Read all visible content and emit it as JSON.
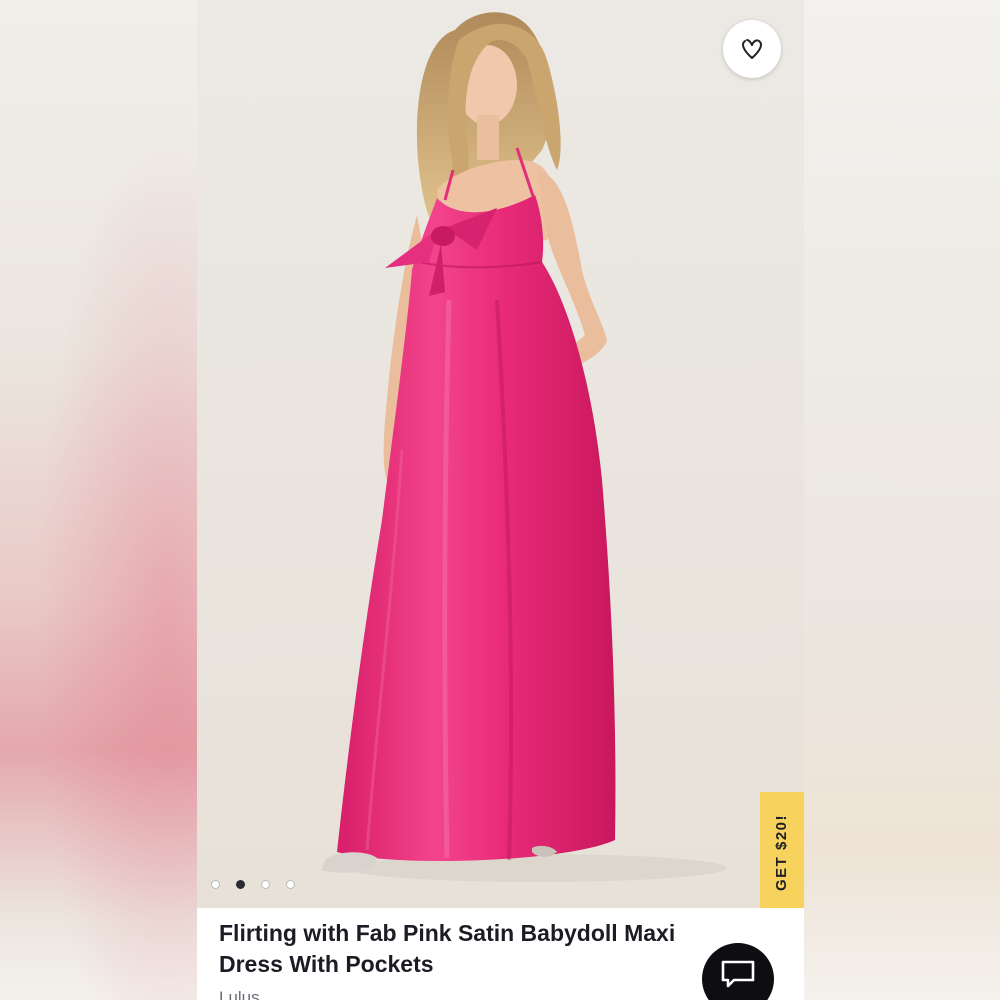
{
  "product": {
    "title": "Flirting with Fab Pink Satin Babydoll Maxi Dress With Pockets",
    "brand": "Lulus"
  },
  "promo": {
    "label": "GET $20!",
    "color": "#f7d35d"
  },
  "carousel": {
    "count": 4,
    "active_index": 1
  },
  "icons": {
    "like": "heart-icon",
    "chat": "chat-bubble-icon"
  },
  "colors": {
    "dress": "#ee2b7a",
    "dot_active": "#2b2b33",
    "chat_button": "#0d0d12"
  }
}
